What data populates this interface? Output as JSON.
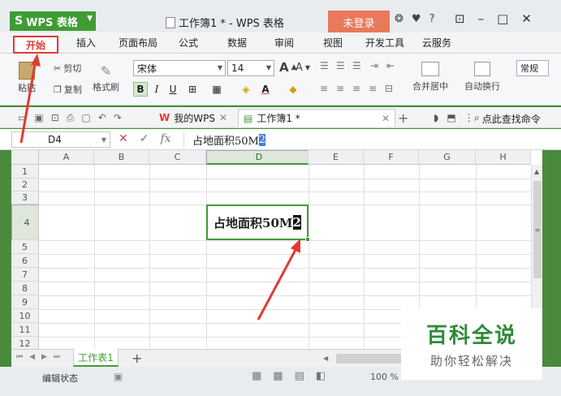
{
  "titlebar": {
    "app_button": "WPS 表格",
    "doc_title": "工作簿1 * - WPS 表格",
    "login_button": "未登录",
    "help_label": "?"
  },
  "ribbon_tabs": [
    "开始",
    "插入",
    "页面布局",
    "公式",
    "数据",
    "审阅",
    "视图",
    "开发工具",
    "云服务"
  ],
  "ribbon": {
    "paste_label": "粘贴",
    "cut_label": "剪切",
    "copy_label": "复制",
    "format_painter_label": "格式刷",
    "font_name": "宋体",
    "font_size": "14",
    "bold": "B",
    "italic": "I",
    "underline": "U",
    "font_grow": "A",
    "font_shrink": "A",
    "font_color": "A",
    "merge_center_label": "合并居中",
    "wrap_text_label": "自动换行",
    "normal_label": "常规"
  },
  "quick_toolbar": {
    "tab_mywps": "我的WPS",
    "tab_workbook": "工作簿1 *",
    "new_tab": "+",
    "find_command": "点此查找命令"
  },
  "formula_bar": {
    "cell_ref": "D4",
    "fx": "fx",
    "content_main": "占地面积50M",
    "content_selected": "2"
  },
  "sheet": {
    "columns": [
      "A",
      "B",
      "C",
      "D",
      "E",
      "F",
      "G",
      "H"
    ],
    "rows": [
      "1",
      "2",
      "3",
      "4",
      "5",
      "6",
      "7",
      "8",
      "9",
      "10",
      "11",
      "12"
    ],
    "active_cell_main": "占地面积50M",
    "active_cell_selected": "2"
  },
  "sheet_tabs": {
    "active": "工作表1",
    "add": "+"
  },
  "status": {
    "mode": "编辑状态",
    "zoom": "100 %"
  },
  "watermark": {
    "title": "百科全说",
    "subtitle": "助你轻松解决"
  },
  "colors": {
    "accent_green": "#3f9c35",
    "highlight_red": "#e23a33",
    "login_orange": "#e8795a",
    "selection_blue": "#3d7fd9"
  }
}
